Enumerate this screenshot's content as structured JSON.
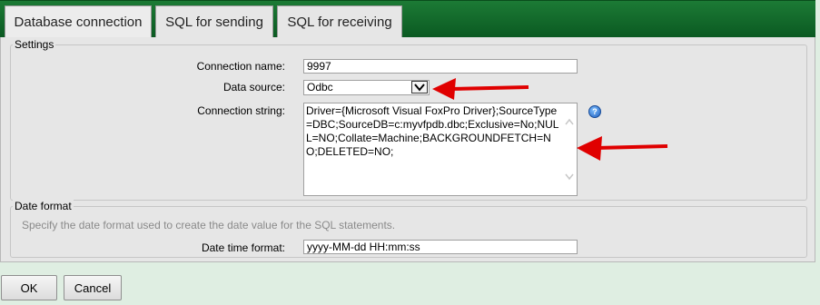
{
  "tabs": [
    {
      "label": "Database connection",
      "active": true
    },
    {
      "label": "SQL for sending",
      "active": false
    },
    {
      "label": "SQL for receiving",
      "active": false
    }
  ],
  "settings": {
    "title": "Settings",
    "connection_name_label": "Connection name:",
    "connection_name_value": "9997",
    "data_source_label": "Data source:",
    "data_source_value": "Odbc",
    "connection_string_label": "Connection string:",
    "connection_string_value": "Driver={Microsoft Visual FoxPro Driver};SourceType=DBC;SourceDB=c:myvfpdb.dbc;Exclusive=No;NULL=NO;Collate=Machine;BACKGROUNDFETCH=NO;DELETED=NO;"
  },
  "date_format": {
    "title": "Date format",
    "hint": "Specify the date format used to create the date value for the SQL statements.",
    "label": "Date time format:",
    "value": "yyyy-MM-dd HH:mm:ss"
  },
  "buttons": {
    "ok": "OK",
    "cancel": "Cancel"
  },
  "colors": {
    "tabbar": "#0b5a22",
    "annotation_arrow": "#e00000",
    "background": "#dfeee2"
  },
  "icons": {
    "help": "help-icon",
    "dropdown": "chevron-down-icon",
    "arrow": "red-arrow-icon"
  }
}
